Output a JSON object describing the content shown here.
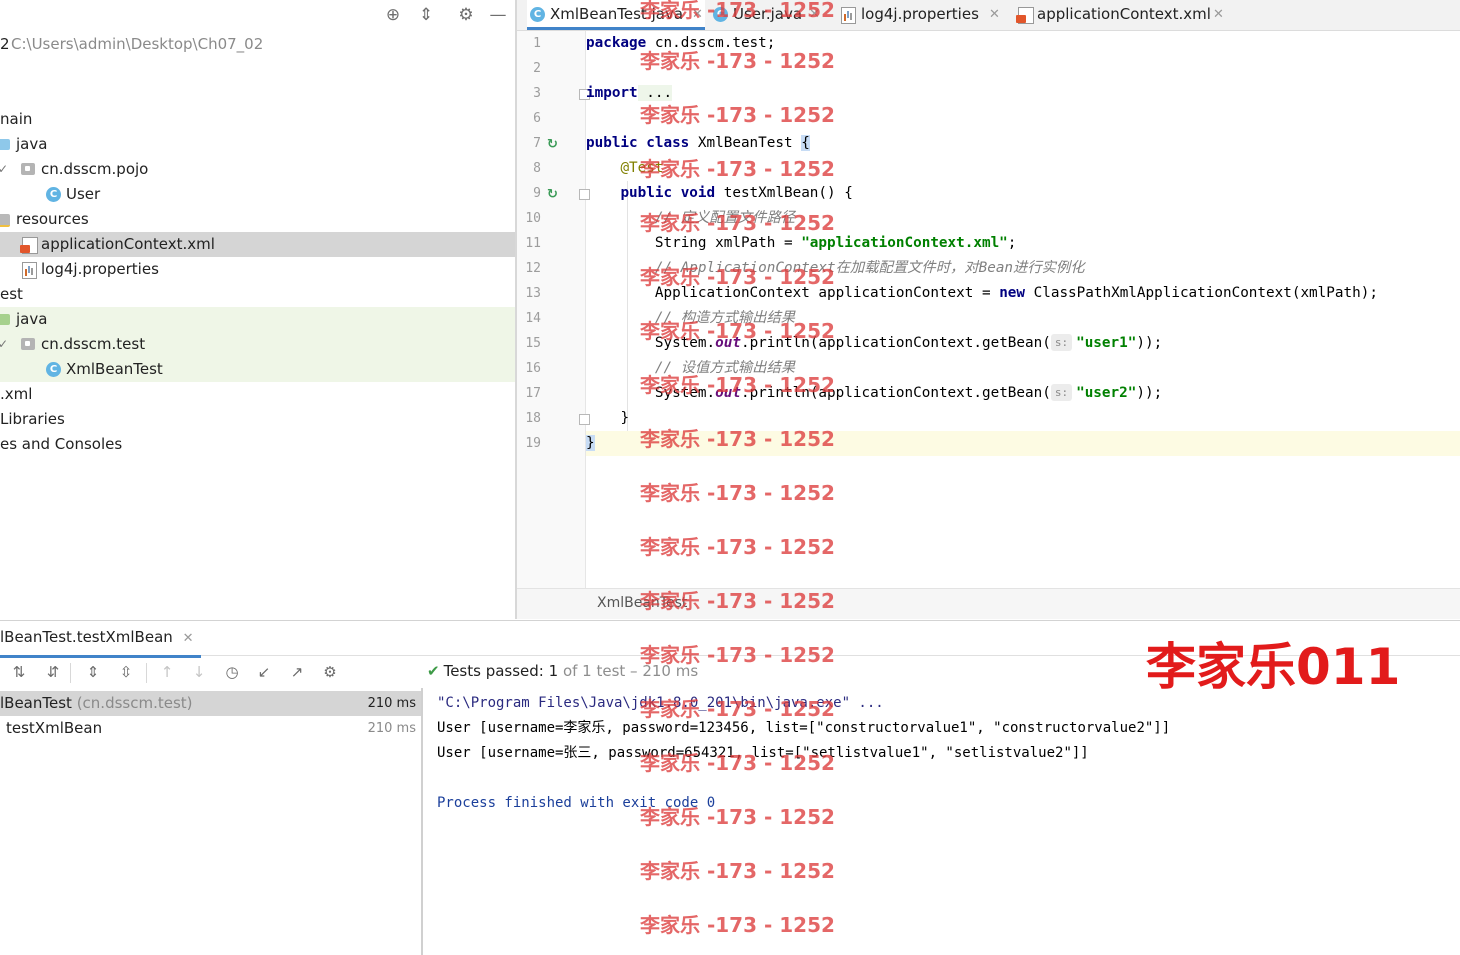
{
  "project": {
    "toolbar_icons": [
      "locate-icon",
      "collapse-icon",
      "gear-icon",
      "minimize-icon"
    ],
    "root_path_prefix": "2",
    "root_path": "C:\\Users\\admin\\Desktop\\Ch07_02",
    "tree": {
      "main": "nain",
      "main_java": "java",
      "pkg_pojo": "cn.dsscm.pojo",
      "class_user": "User",
      "resources": "resources",
      "app_context": "applicationContext.xml",
      "log4j": "log4j.properties",
      "test": "est",
      "test_java": "java",
      "pkg_test": "cn.dsscm.test",
      "class_test": "XmlBeanTest",
      "pom": ".xml",
      "libs": " Libraries",
      "scratches": "es and Consoles"
    }
  },
  "editor": {
    "tabs": [
      {
        "label": "XmlBeanTest.java",
        "active": true
      },
      {
        "label": "User.java",
        "active": false
      },
      {
        "label": "log4j.properties",
        "active": false
      },
      {
        "label": "applicationContext.xml",
        "active": false
      }
    ],
    "line_numbers": [
      "1",
      "2",
      "3",
      "6",
      "7",
      "8",
      "9",
      "10",
      "11",
      "12",
      "13",
      "14",
      "15",
      "16",
      "17",
      "18",
      "19"
    ],
    "code": {
      "l1_kw": "package",
      "l1_rest": " cn.dsscm.test;",
      "l3_kw": "import",
      "l3_rest": " ...",
      "l7_kw": "public class",
      "l7_rest": " XmlBeanTest ",
      "l7_brace": "{",
      "l8_ann": "@Test",
      "l9_kw": "public void",
      "l9_rest": " testXmlBean() {",
      "l10_cmt": "// 定义配置文件路径",
      "l11_a": "String xmlPath = ",
      "l11_str": "\"applicationContext.xml\"",
      "l11_b": ";",
      "l12_cmt": "// ApplicationContext在加载配置文件时，对Bean进行实例化",
      "l13_a": "ApplicationContext applicationContext = ",
      "l13_kw": "new",
      "l13_b": " ClassPathXmlApplicationContext(xmlPath);",
      "l14_cmt": "// 构造方式输出结果",
      "l15_a": "System.",
      "l15_fld": "out",
      "l15_b": ".println(applicationContext.getBean(",
      "l15_hint": "s:",
      "l15_str": "\"user1\"",
      "l15_c": "));",
      "l16_cmt": "// 设值方式输出结果",
      "l17_a": "System.",
      "l17_fld": "out",
      "l17_b": ".println(applicationContext.getBean(",
      "l17_hint": "s:",
      "l17_str": "\"user2\"",
      "l17_c": "));",
      "l18": "}",
      "l19": "}"
    },
    "breadcrumb": "XmlBeanTest"
  },
  "run": {
    "tab_label": "lBeanTest.testXmlBean",
    "status_prefix": "Tests passed: ",
    "status_count": "1",
    "status_suffix": " of 1 test – 210 ms",
    "tests": [
      {
        "name": "lBeanTest",
        "pkg": " (cn.dsscm.test)",
        "time": "210 ms"
      },
      {
        "name": "testXmlBean",
        "time": "210 ms"
      }
    ],
    "console": [
      "\"C:\\Program Files\\Java\\jdk1.8.0_201\\bin\\java.exe\" ...",
      "User [username=李家乐, password=123456, list=[\"constructorvalue1\", \"constructorvalue2\"]]",
      "User [username=张三, password=654321, list=[\"setlistvalue1\", \"setlistvalue2\"]]",
      "",
      "Process finished with exit code 0"
    ]
  },
  "watermark": {
    "text": "李家乐 -173 - 1252",
    "stamp": "李家乐011"
  },
  "colors": {
    "accent": "#4083c9",
    "keyword": "#000080",
    "string": "#008000",
    "watermark": "#dc3c3c"
  }
}
